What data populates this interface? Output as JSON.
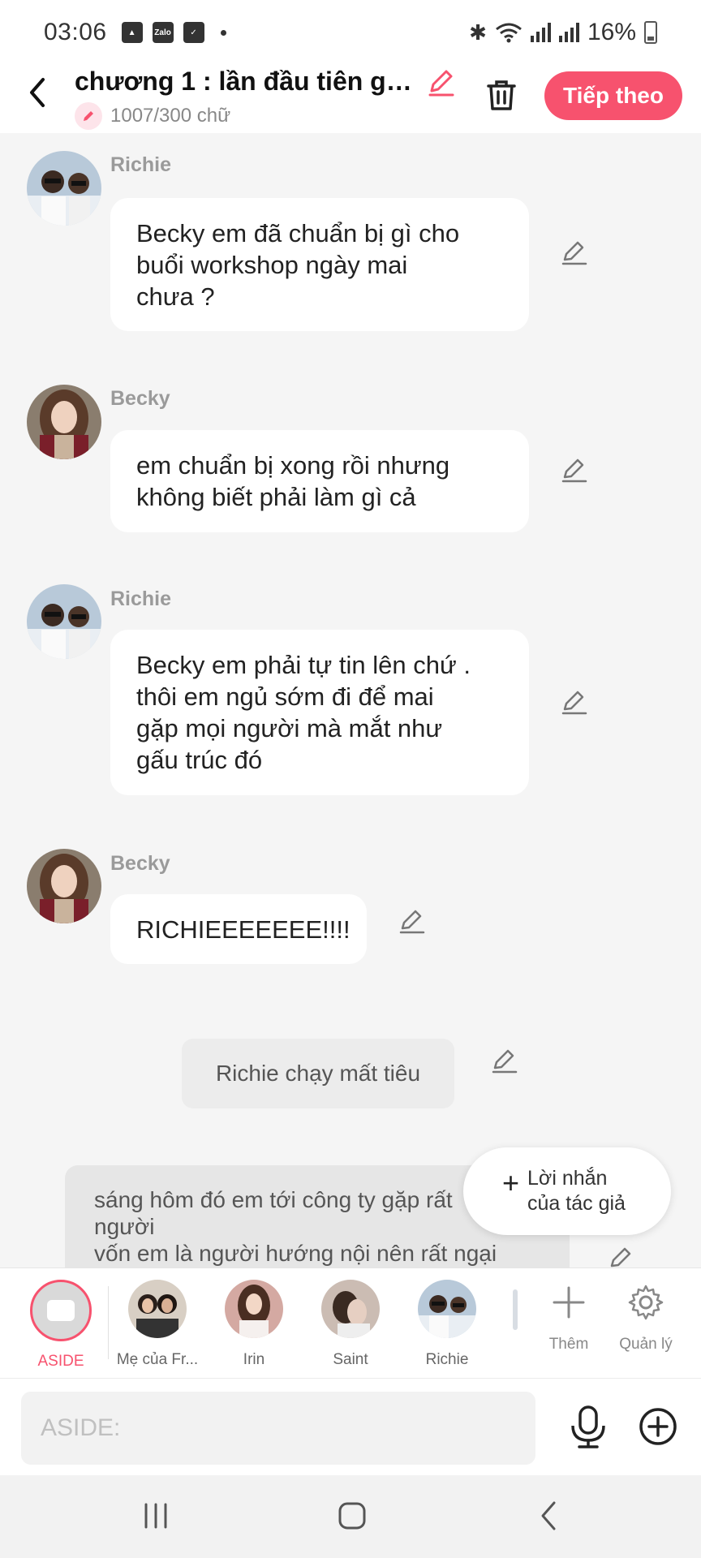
{
  "status_bar": {
    "time": "03:06",
    "app_icon_label": "Zalo",
    "battery": "16%"
  },
  "header": {
    "title": "chương 1 : lần đầu tiên gặ...",
    "word_count": "1007/300 chữ",
    "next_label": "Tiếp theo",
    "accent_color": "#f7526e"
  },
  "messages": [
    {
      "sender": "Richie",
      "text_lines": [
        "Becky em đã chuẩn bị gì cho",
        "buổi workshop ngày mai",
        "chưa ?"
      ]
    },
    {
      "sender": "Becky",
      "text_lines": [
        "em chuẩn bị xong rồi nhưng",
        "không biết phải làm gì cả"
      ]
    },
    {
      "sender": "Richie",
      "text_lines": [
        "Becky em phải tự tin lên chứ .",
        "thôi em ngủ sớm đi để mai",
        "gặp mọi người mà mắt như",
        "gấu trúc đó"
      ]
    },
    {
      "sender": "Becky",
      "text_lines": [
        "RICHIEEEEEEE!!!!"
      ]
    }
  ],
  "narration": "Richie chạy mất tiêu",
  "aside_block": {
    "lines": [
      "sáng hôm đó em tới công ty gặp rất",
      "người",
      "vốn em là người hướng nội nên rất ngại"
    ]
  },
  "floating_button": {
    "lines": [
      "Lời nhắn",
      "của tác giả"
    ]
  },
  "characters": {
    "aside_label": "ASIDE",
    "items": [
      {
        "name": "Mẹ của Fr..."
      },
      {
        "name": "Irin"
      },
      {
        "name": "Saint"
      },
      {
        "name": "Richie"
      }
    ],
    "add_label": "Thêm",
    "manage_label": "Quản lý"
  },
  "input": {
    "placeholder": "ASIDE:"
  }
}
